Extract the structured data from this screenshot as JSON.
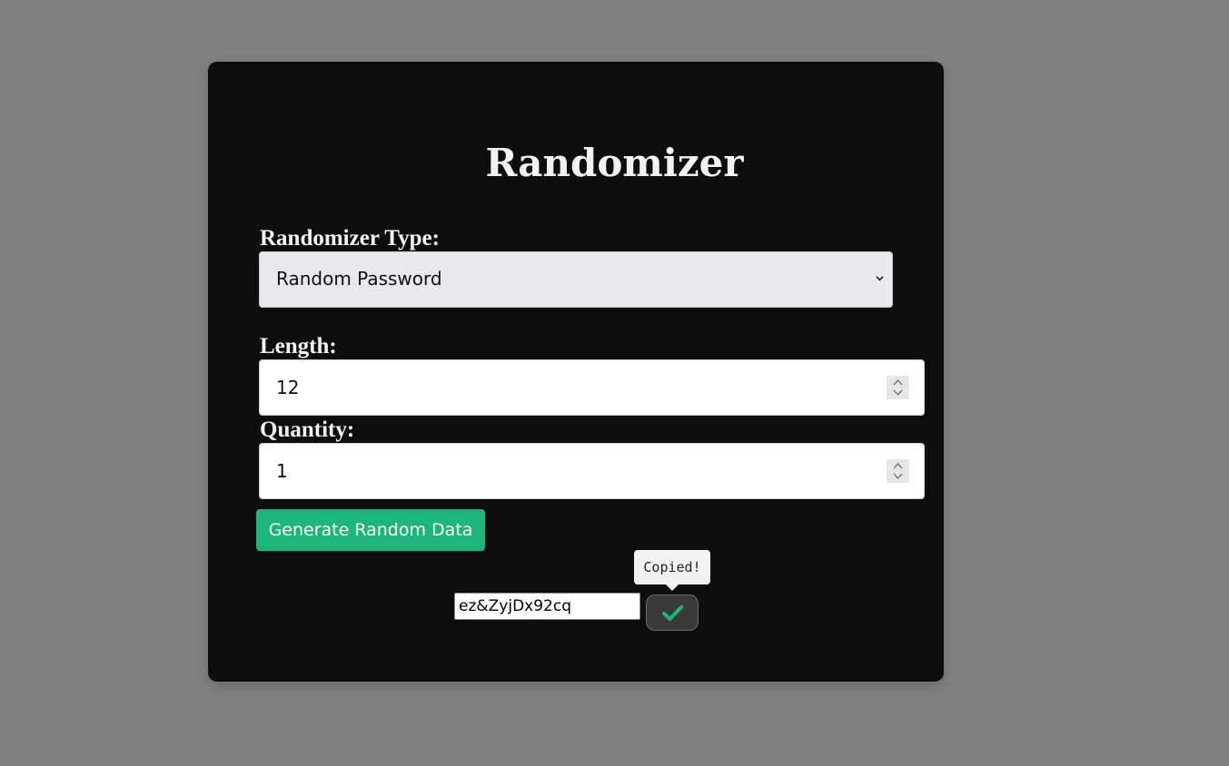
{
  "app": {
    "title": "Randomizer"
  },
  "form": {
    "type_label": "Randomizer Type:",
    "type_selected": "Random Password",
    "length_label": "Length:",
    "length_value": "12",
    "quantity_label": "Quantity:",
    "quantity_value": "1",
    "generate_label": "Generate Random Data"
  },
  "result": {
    "value": "ez&ZyjDx92cq",
    "tooltip": "Copied!",
    "copy_icon": "check-icon"
  },
  "colors": {
    "background": "#808080",
    "card": "#0e0e0e",
    "accent": "#1db67a",
    "copy_button": "#3a3a3a"
  }
}
